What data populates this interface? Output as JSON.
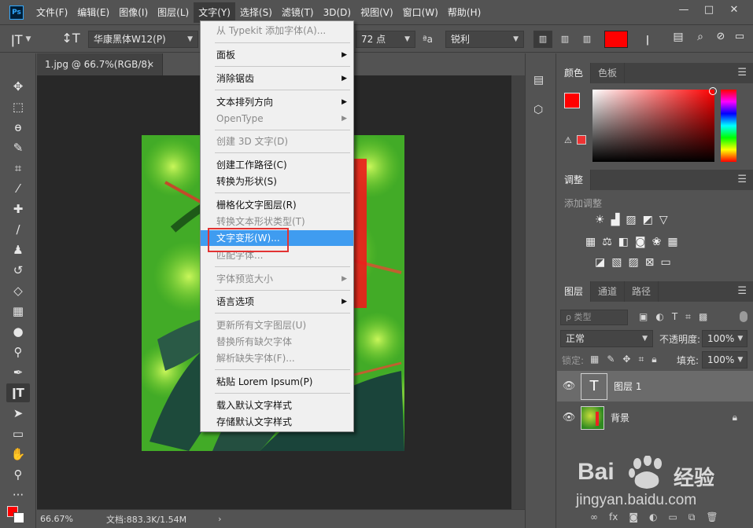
{
  "app": {
    "logo": "Ps"
  },
  "menubar": {
    "items": [
      "文件(F)",
      "编辑(E)",
      "图像(I)",
      "图层(L)",
      "文字(Y)",
      "选择(S)",
      "滤镜(T)",
      "3D(D)",
      "视图(V)",
      "窗口(W)",
      "帮助(H)"
    ],
    "active_index": 4
  },
  "window_controls": {
    "minimize": "—",
    "restore": "□",
    "close": "✕"
  },
  "options": {
    "font_family": "华康黑体W12(P)",
    "font_size": "72 点",
    "aa_label": "ªa",
    "antialias": "锐利",
    "text_color": "#ff0000"
  },
  "document": {
    "tab_title": "1.jpg @ 66.7%(RGB/8)",
    "zoom": "66.67%",
    "doc_info": "文档:883.3K/1.54M"
  },
  "type_menu": {
    "items": [
      {
        "label": "从 Typekit 添加字体(A)...",
        "disabled": true
      },
      {
        "label": "面板",
        "submenu": true
      },
      {
        "label": "消除锯齿",
        "submenu": true
      },
      {
        "label": "文本排列方向",
        "submenu": true
      },
      {
        "label": "OpenType",
        "submenu": true,
        "disabled": true
      },
      {
        "label": "创建 3D 文字(D)",
        "disabled": true
      },
      {
        "label": "创建工作路径(C)"
      },
      {
        "label": "转换为形状(S)"
      },
      {
        "label": "栅格化文字图层(R)"
      },
      {
        "label": "转换文本形状类型(T)",
        "disabled": true
      },
      {
        "label": "文字变形(W)...",
        "highlighted": true
      },
      {
        "label": "匹配字体...",
        "disabled": true
      },
      {
        "label": "字体预览大小",
        "submenu": true,
        "disabled": true
      },
      {
        "label": "语言选项",
        "submenu": true
      },
      {
        "label": "更新所有文字图层(U)",
        "disabled": true
      },
      {
        "label": "替换所有缺欠字体",
        "disabled": true
      },
      {
        "label": "解析缺失字体(F)...",
        "disabled": true
      },
      {
        "label": "粘贴 Lorem Ipsum(P)"
      },
      {
        "label": "载入默认文字样式"
      },
      {
        "label": "存储默认文字样式"
      }
    ]
  },
  "color_panel": {
    "tabs": [
      "颜色",
      "色板"
    ],
    "foreground": "#ff0000",
    "background": "#ffffff"
  },
  "adjust_panel": {
    "tab": "调整",
    "hint": "添加调整"
  },
  "layers_panel": {
    "tabs": [
      "图层",
      "通道",
      "路径"
    ],
    "filter_kind": "ρ 类型",
    "blend_mode": "正常",
    "opacity_label": "不透明度:",
    "opacity": "100%",
    "lock_label": "锁定:",
    "fill_label": "填充:",
    "fill": "100%",
    "layers": [
      {
        "name": "图层 1",
        "thumb": "T",
        "selected": true
      },
      {
        "name": "背景",
        "locked": true
      }
    ]
  },
  "watermark": {
    "brand": "Bai",
    "brand2": "经验",
    "url": "jingyan.baidu.com"
  }
}
